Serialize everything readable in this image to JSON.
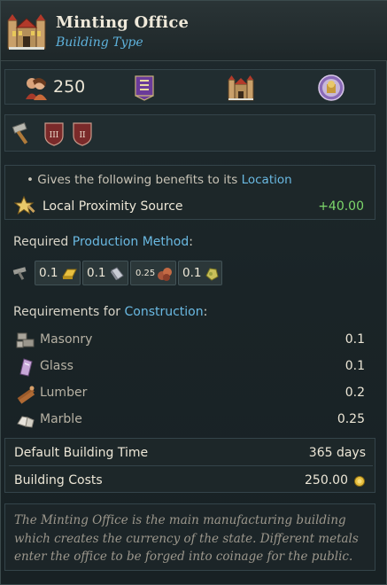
{
  "header": {
    "title": "Minting Office",
    "subtitle": "Building Type",
    "icon": "minting-office-building-icon"
  },
  "stats": {
    "population": "250",
    "icons": [
      "population-icon",
      "purple-banner-icon",
      "owner-building-icon",
      "merchant-estate-icon"
    ]
  },
  "tags": {
    "icons": [
      "hammer-icon",
      "tier-iii-shield-icon",
      "tier-ii-shield-icon"
    ],
    "shield_labels": [
      "III",
      "II"
    ]
  },
  "benefits": {
    "intro_prefix": "• Gives the following benefits to its ",
    "intro_link": "Location",
    "modifier_label": "Local Proximity Source",
    "modifier_value": "+40.00"
  },
  "production": {
    "label_prefix": "Required ",
    "label_link": "Production Method",
    "label_suffix": ":",
    "items": [
      {
        "value": "0.1",
        "icon": "gold-ingot-icon"
      },
      {
        "value": "0.1",
        "icon": "silver-ingot-icon"
      },
      {
        "value": "0.25",
        "icon": "copper-ore-icon"
      },
      {
        "value": "0.1",
        "icon": "alloy-nugget-icon"
      }
    ]
  },
  "construction": {
    "label_prefix": "Requirements for ",
    "label_link": "Construction",
    "label_suffix": ":",
    "items": [
      {
        "name": "Masonry",
        "value": "0.1",
        "icon": "masonry-icon"
      },
      {
        "name": "Glass",
        "value": "0.1",
        "icon": "glass-icon"
      },
      {
        "name": "Lumber",
        "value": "0.2",
        "icon": "lumber-icon"
      },
      {
        "name": "Marble",
        "value": "0.25",
        "icon": "marble-icon"
      }
    ]
  },
  "costs": {
    "build_time_label": "Default Building Time",
    "build_time_value": "365 days",
    "cost_label": "Building Costs",
    "cost_value": "250.00"
  },
  "description": "The Minting Office is the main manufacturing building which creates the currency of the state. Different metals enter the office to be forged into coinage for the public.",
  "colors": {
    "accent_blue": "#6ab9e2",
    "positive_green": "#7dd86b",
    "panel_bg": "#212d30"
  }
}
